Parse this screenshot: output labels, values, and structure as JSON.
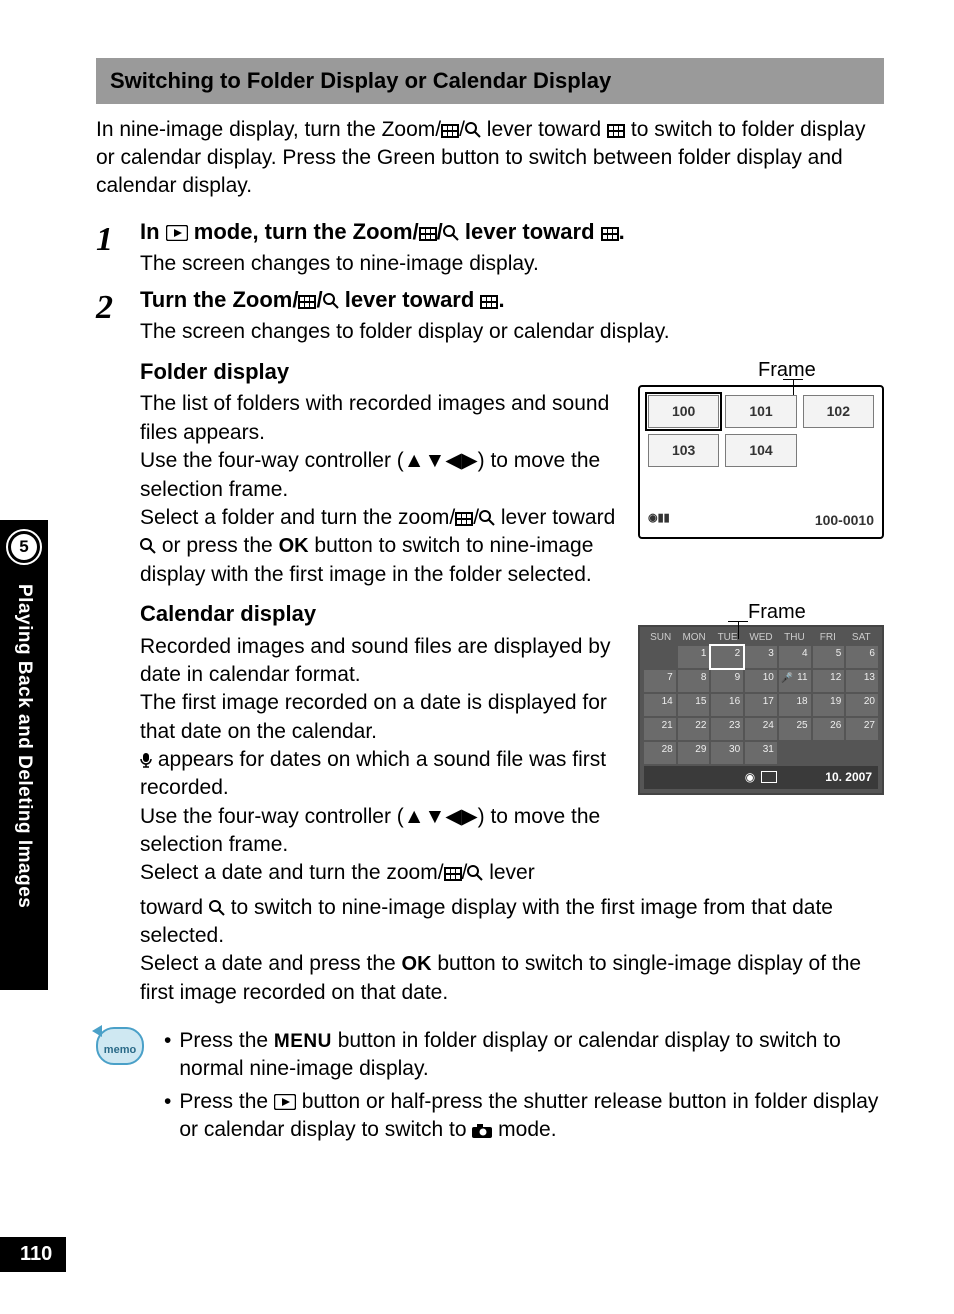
{
  "header": "Switching to Folder Display or Calendar Display",
  "intro": "In nine-image display, turn the Zoom/⧉/🔍 lever toward ⧉ to switch to folder display or calendar display. Press the Green button to switch between folder display and calendar display.",
  "steps": [
    {
      "num": "1",
      "title_pre": "In ",
      "title_post": " mode, turn the Zoom/⧉/🔍 lever toward ⧉.",
      "desc": "The screen changes to nine-image display."
    },
    {
      "num": "2",
      "title": "Turn the Zoom/⧉/🔍 lever toward ⧉.",
      "desc": "The screen changes to folder display or calendar display."
    }
  ],
  "folder": {
    "title": "Folder display",
    "body1": "The list of folders with recorded images and sound files appears.",
    "body2": "Use the four-way controller (▲▼◀▶) to move the selection frame.",
    "body3_pre": "Select a folder and turn the zoom/⧉/🔍 lever toward 🔍 or press the ",
    "body3_ok": "OK",
    "body3_post": " button to switch to nine-image display with the first image in the folder selected.",
    "frame_label": "Frame",
    "cells": [
      "100",
      "101",
      "102",
      "103",
      "104"
    ],
    "status": "100-0010"
  },
  "calendar": {
    "title": "Calendar display",
    "body1": "Recorded images and sound files are displayed by date in calendar format.",
    "body2": "The first image recorded on a date is displayed for that date on the calendar.",
    "body3_pre": "🎤 appears for dates on which a sound file was first recorded.",
    "body4": "Use the four-way controller (▲▼◀▶) to move the selection frame.",
    "body5": "Select a date and turn the zoom/⧉/🔍 lever toward 🔍 to switch to nine-image display with the first image from that date selected.",
    "body6_pre": "Select a date and press the ",
    "body6_ok": "OK",
    "body6_post": " button to switch to single-image display of the first image recorded on that date.",
    "frame_label": "Frame",
    "days": [
      "SUN",
      "MON",
      "TUE",
      "WED",
      "THU",
      "FRI",
      "SAT"
    ],
    "cells": [
      "",
      "1",
      "2",
      "3",
      "4",
      "5",
      "6",
      "7",
      "8",
      "9",
      "10",
      "11",
      "12",
      "13",
      "14",
      "15",
      "16",
      "17",
      "18",
      "19",
      "20",
      "21",
      "22",
      "23",
      "24",
      "25",
      "26",
      "27",
      "28",
      "29",
      "30",
      "31",
      "",
      "",
      ""
    ],
    "footer_date": "10. 2007"
  },
  "memo": {
    "label": "memo",
    "item1_pre": "Press the ",
    "item1_menu": "MENU",
    "item1_post": " button in folder display or calendar display to switch to normal nine-image display.",
    "item2_pre": "Press the ",
    "item2_post": " button or half-press the shutter release button in folder display or calendar display to switch to ",
    "item2_end": " mode."
  },
  "side": {
    "num": "5",
    "text": "Playing Back and Deleting Images"
  },
  "page_num": "110"
}
